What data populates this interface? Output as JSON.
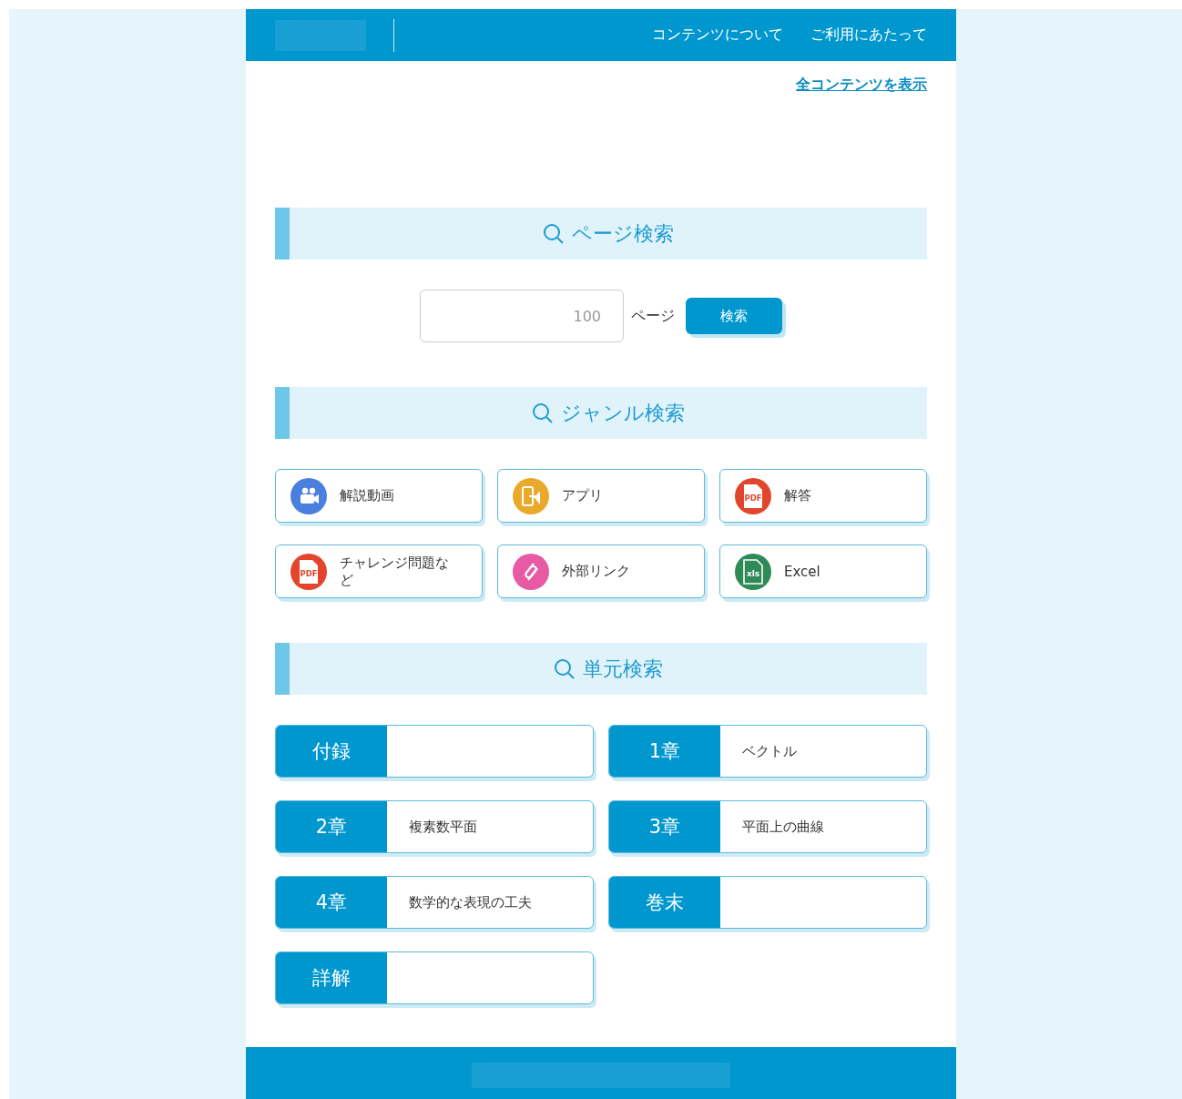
{
  "header": {
    "nav": [
      "コンテンツについて",
      "ご利用にあたって"
    ]
  },
  "all_contents_link": "全コンテンツを表示",
  "page_search": {
    "title": "ページ検索",
    "placeholder": "100",
    "unit": "ページ",
    "button": "検索"
  },
  "genre_search": {
    "title": "ジャンル検索",
    "items": [
      {
        "label": "解説動画",
        "kind": "video",
        "color": "#4a7fe0"
      },
      {
        "label": "アプリ",
        "kind": "app",
        "color": "#eaa92a"
      },
      {
        "label": "解答",
        "kind": "pdf",
        "color": "#e2452b",
        "icon_text": "PDF"
      },
      {
        "label": "チャレンジ問題など",
        "kind": "pdf",
        "color": "#e2452b",
        "icon_text": "PDF"
      },
      {
        "label": "外部リンク",
        "kind": "link",
        "color": "#e75ba5"
      },
      {
        "label": "Excel",
        "kind": "excel",
        "color": "#2e8b57",
        "icon_text": "xls"
      }
    ]
  },
  "unit_search": {
    "title": "単元検索",
    "items": [
      {
        "tag": "付録"
      },
      {
        "tag": "1章",
        "name": "ベクトル"
      },
      {
        "tag": "2章",
        "name": "複素数平面"
      },
      {
        "tag": "3章",
        "name": "平面上の曲線"
      },
      {
        "tag": "4章",
        "name": "数学的な表現の工夫"
      },
      {
        "tag": "巻末"
      },
      {
        "tag": "詳解"
      }
    ]
  }
}
